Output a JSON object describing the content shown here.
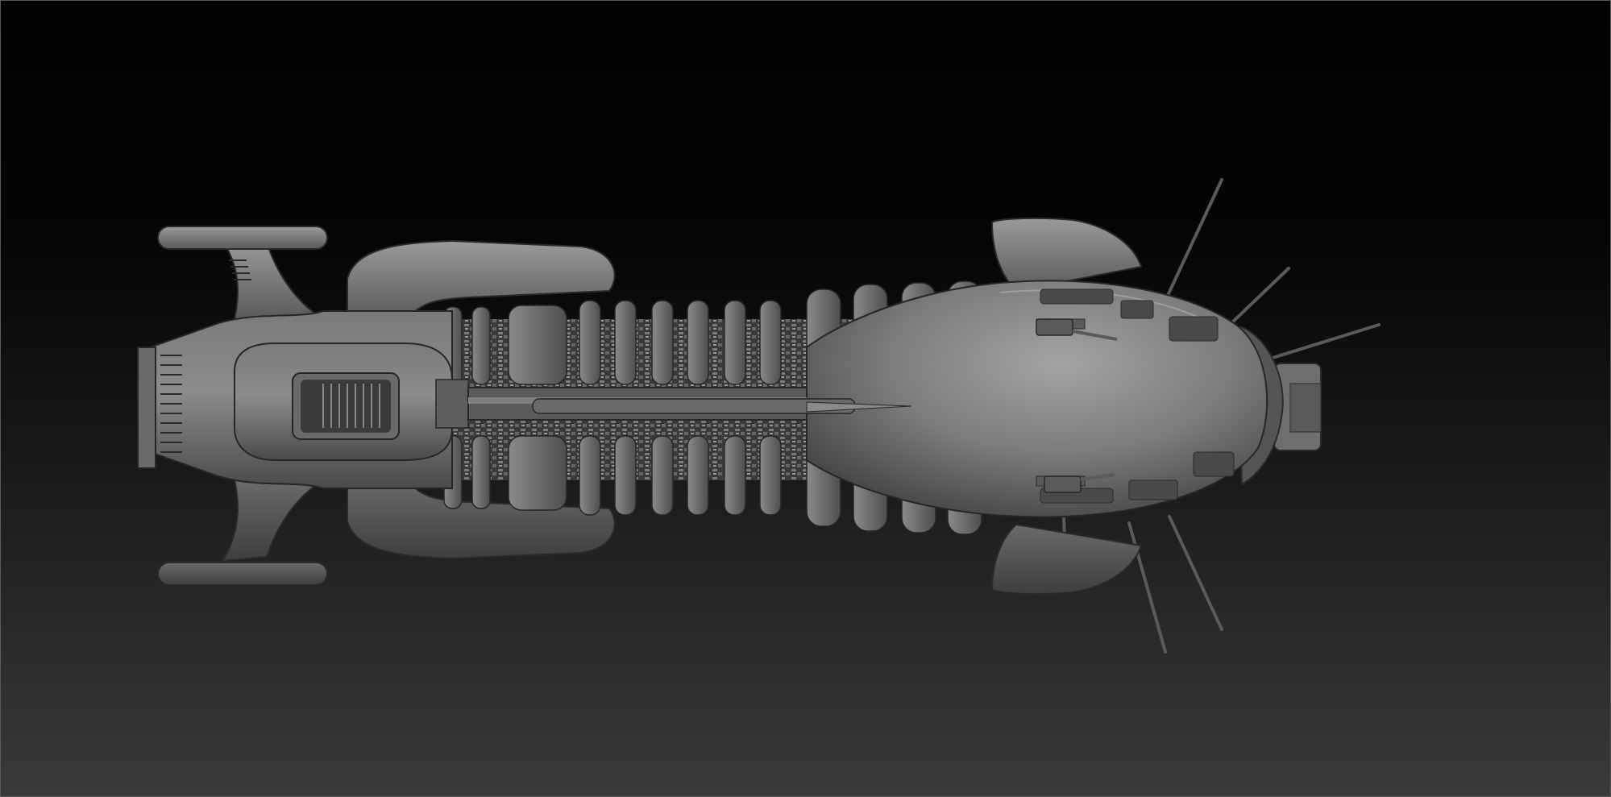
{
  "scene": {
    "subject": "spaceship-model",
    "view": "top",
    "colors": {
      "background_top": "#000000",
      "background_bottom": "#3a3a3a",
      "material_light": "#9a9a9a",
      "material_mid": "#6e6e6e",
      "material_dark": "#3c3c3c",
      "edge": "#1e1e1e"
    }
  }
}
